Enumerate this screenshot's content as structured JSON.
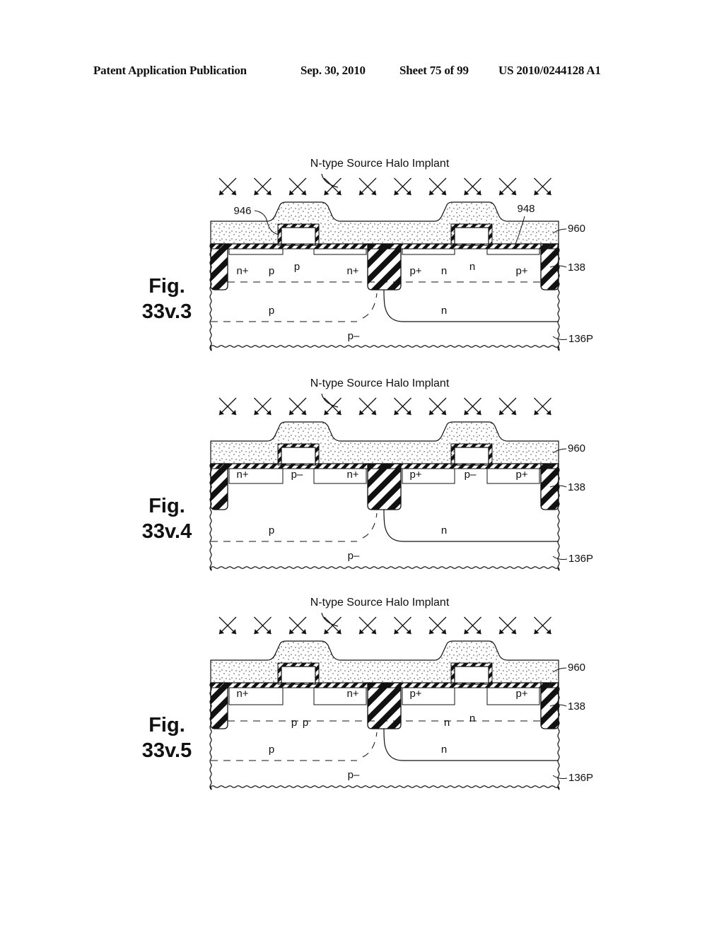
{
  "header": {
    "left": "Patent Application Publication",
    "date": "Sep. 30, 2010",
    "sheet": "Sheet 75 of 99",
    "number": "US 2010/0244128 A1"
  },
  "figures": [
    {
      "id": "33v.3",
      "label_line1": "Fig.",
      "label_line2": "33v.3",
      "implant_title": "N-type Source Halo Implant",
      "arrow_count": 10,
      "refs": {
        "left_gate": "946",
        "right_gate": "948",
        "oxide": "960",
        "trench": "138",
        "substrate": "136P"
      },
      "variant": "shallow",
      "regions": {
        "nmos": [
          "n+",
          "p",
          "p",
          "n+"
        ],
        "pmos": [
          "p+",
          "n",
          "n",
          "p+"
        ],
        "well_left": "p",
        "well_right": "n",
        "substrate": "p–"
      }
    },
    {
      "id": "33v.4",
      "label_line1": "Fig.",
      "label_line2": "33v.4",
      "implant_title": "N-type Source Halo Implant",
      "arrow_count": 10,
      "refs": {
        "oxide": "960",
        "trench": "138",
        "substrate": "136P"
      },
      "variant": "deep",
      "regions": {
        "nmos": [
          "n+",
          "p–",
          "n+"
        ],
        "pmos": [
          "p+",
          "p–",
          "p+"
        ],
        "well_left": "p",
        "well_right": "n",
        "substrate": "p–"
      }
    },
    {
      "id": "33v.5",
      "label_line1": "Fig.",
      "label_line2": "33v.5",
      "implant_title": "N-type Source Halo Implant",
      "arrow_count": 10,
      "refs": {
        "oxide": "960",
        "trench": "138",
        "substrate": "136P"
      },
      "variant": "halo",
      "regions": {
        "nmos": [
          "n+",
          "p",
          "p",
          "n+"
        ],
        "pmos": [
          "p+",
          "n",
          "n",
          "p+"
        ],
        "well_left": "p",
        "well_right": "n",
        "substrate": "p–"
      }
    }
  ]
}
